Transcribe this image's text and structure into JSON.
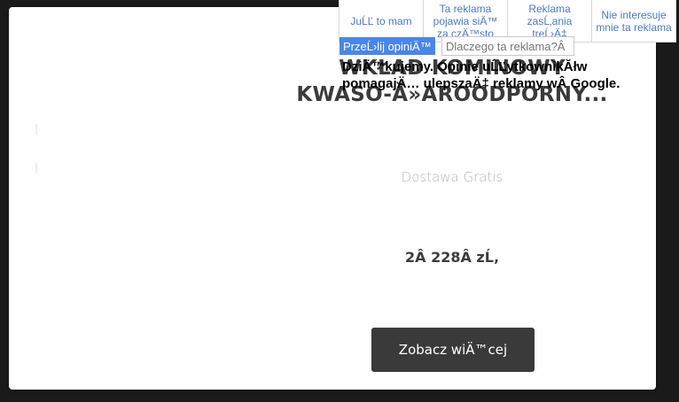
{
  "product": {
    "title_line1": "WKŁAD KOMINOWY",
    "title_line2": "KWASO-Ă»AROODPORNY...",
    "shipping": "Dostawa Gratis",
    "price": "2Â 228Â zĹ‚",
    "cta_label": "Zobacz wiÄ™cej"
  },
  "feedback_menu": {
    "options": [
      "JuĹĽ to mam",
      "Ta reklama pojawia siÄ™ za czÄ™sto",
      "Reklama zasĹ‚ania treĹ›Ä‡",
      "Nie interesuje mnie ta reklama"
    ],
    "submit_label": "PrzeĹ›lij opiniÄ™",
    "why_placeholder": "Dlaczego ta reklama?Â",
    "thanks_message": "DziÄ™kujemy. Opinie uĹĽytkownikĂłw pomagajÄ… ulepszaÄ‡ reklamy wÂ Google."
  },
  "colors": {
    "page_bg": "#1a1a1a",
    "link_blue": "#4d79c7",
    "submit_blue": "#4a86e8",
    "cta_bg": "#3a3a3a"
  }
}
